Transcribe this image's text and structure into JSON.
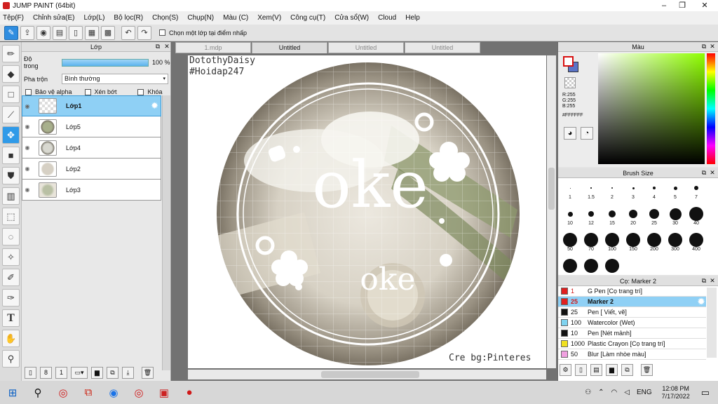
{
  "window": {
    "title": "JUMP PAINT (64bit)",
    "min": "–",
    "max": "❐",
    "close": "✕"
  },
  "menu": [
    "Tệp(F)",
    "Chỉnh sửa(E)",
    "Lớp(L)",
    "Bộ lọc(R)",
    "Chọn(S)",
    "Chụp(N)",
    "Màu (C)",
    "Xem(V)",
    "Công cụ(T)",
    "Cửa sổ(W)",
    "Cloud",
    "Help"
  ],
  "toolbar": {
    "checkbox_label": "Chọn một lớp tại điểm nhấp"
  },
  "layer_panel": {
    "title": "Lớp",
    "opacity_label": "Độ trong",
    "opacity_value": "100 %",
    "blend_label": "Pha trộn",
    "blend_value": "Bình thường",
    "protect_alpha": "Bảo vệ alpha",
    "clip": "Xén bớt",
    "lock": "Khóa",
    "layers": [
      "Lớp1",
      "Lớp5",
      "Lớp4",
      "Lớp2",
      "Lớp3"
    ]
  },
  "canvas": {
    "tabs": [
      "1.mdp",
      "Untitled",
      "Untitled",
      "Untitled"
    ],
    "signature_line1": "DotothyDaisy",
    "signature_line2": "#Hoidap247",
    "big_text": "oke",
    "small_text": "oke",
    "credit": "Cre bg:Pinteres"
  },
  "color_panel": {
    "title": "Màu",
    "r": "R:255",
    "g": "G:255",
    "b": "B:255",
    "hex": "#FFFFFF"
  },
  "brush_panel": {
    "title": "Brush Size",
    "sizes": [
      "1",
      "1.5",
      "2",
      "3",
      "4",
      "5",
      "7",
      "10",
      "12",
      "15",
      "20",
      "25",
      "30",
      "40",
      "50",
      "70",
      "100",
      "150",
      "200",
      "300",
      "400"
    ]
  },
  "tool_panel": {
    "title": "Cọ: Marker 2",
    "tools": [
      {
        "size": "1",
        "name": "G Pen [Cọ trang trí]",
        "color": "#e02020"
      },
      {
        "size": "25",
        "name": "Marker 2",
        "color": "#e02020"
      },
      {
        "size": "25",
        "name": "Pen [ Viết, vẽ]",
        "color": "#111111"
      },
      {
        "size": "100",
        "name": "Watercolor (Wet)",
        "color": "#7fd3f0"
      },
      {
        "size": "10",
        "name": "Pen [Nét mảnh]",
        "color": "#111111"
      },
      {
        "size": "1000",
        "name": "Plastic Crayon [Cọ trang trí]",
        "color": "#f0e020"
      },
      {
        "size": "50",
        "name": "Blur [Làm nhòe màu]",
        "color": "#f0a0e0"
      }
    ]
  },
  "taskbar": {
    "lang": "ENG",
    "time": "12:08 PM",
    "date": "7/17/2022"
  },
  "colors": {
    "accent": "#2f9ae8",
    "selected_layer": "#8fd0f5",
    "primary_color": "#ffffff"
  }
}
